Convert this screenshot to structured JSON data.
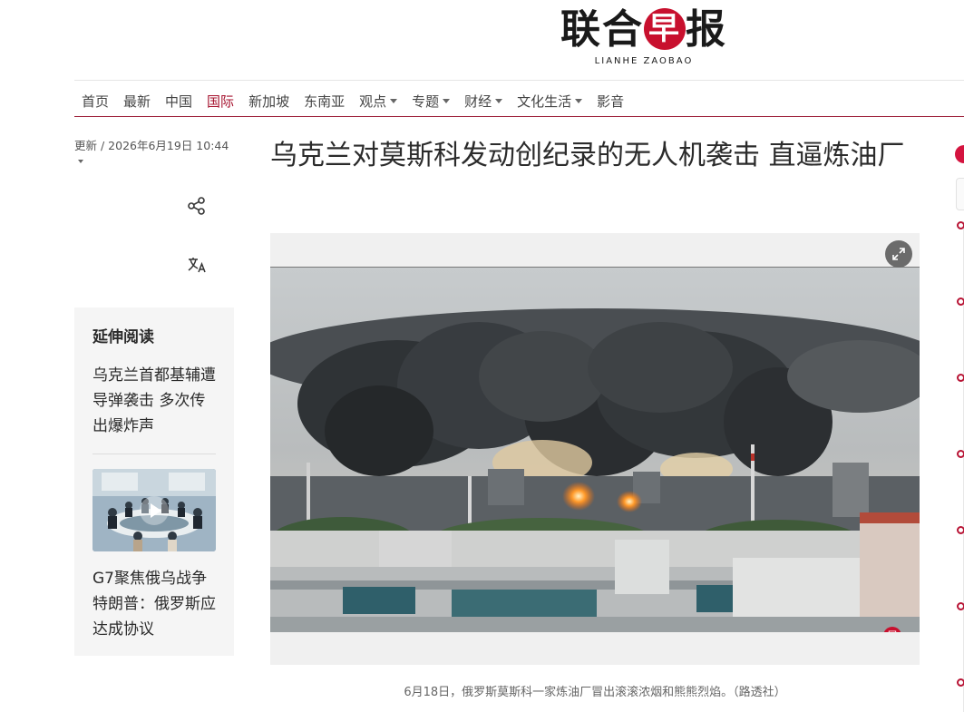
{
  "masthead": {
    "logo_cn_1": "联合",
    "logo_seal": "早",
    "logo_cn_2": "报",
    "logo_en": "LIANHE ZAOBAO"
  },
  "nav": {
    "items": [
      {
        "label": "首页",
        "dropdown": false
      },
      {
        "label": "最新",
        "dropdown": false
      },
      {
        "label": "中国",
        "dropdown": false
      },
      {
        "label": "国际",
        "dropdown": false,
        "active": true
      },
      {
        "label": "新加坡",
        "dropdown": false
      },
      {
        "label": "东南亚",
        "dropdown": false
      },
      {
        "label": "观点",
        "dropdown": true
      },
      {
        "label": "专题",
        "dropdown": true
      },
      {
        "label": "财经",
        "dropdown": true
      },
      {
        "label": "文化生活",
        "dropdown": true
      },
      {
        "label": "影音",
        "dropdown": false
      }
    ],
    "accent_color": "#a5112d"
  },
  "article": {
    "updated": "更新 / 2026年6月19日 10:44",
    "headline": "乌克兰对莫斯科发动创纪录的无人机袭击 直逼炼油厂",
    "caption": "6月18日，俄罗斯莫斯科一家炼油厂冒出滚滚浓烟和熊熊烈焰。（路透社）",
    "watermark": "早"
  },
  "tools": {
    "share_icon": "share-icon",
    "translate_icon": "translate-icon",
    "expand_icon": "expand-icon"
  },
  "related": {
    "heading": "延伸阅读",
    "items": [
      {
        "title": "乌克兰首都基辅遭导弹袭击 多次传出爆炸声",
        "has_video": false
      },
      {
        "title": "G7聚焦俄乌战争 特朗普：俄罗斯应达成协议",
        "has_video": true
      }
    ]
  }
}
